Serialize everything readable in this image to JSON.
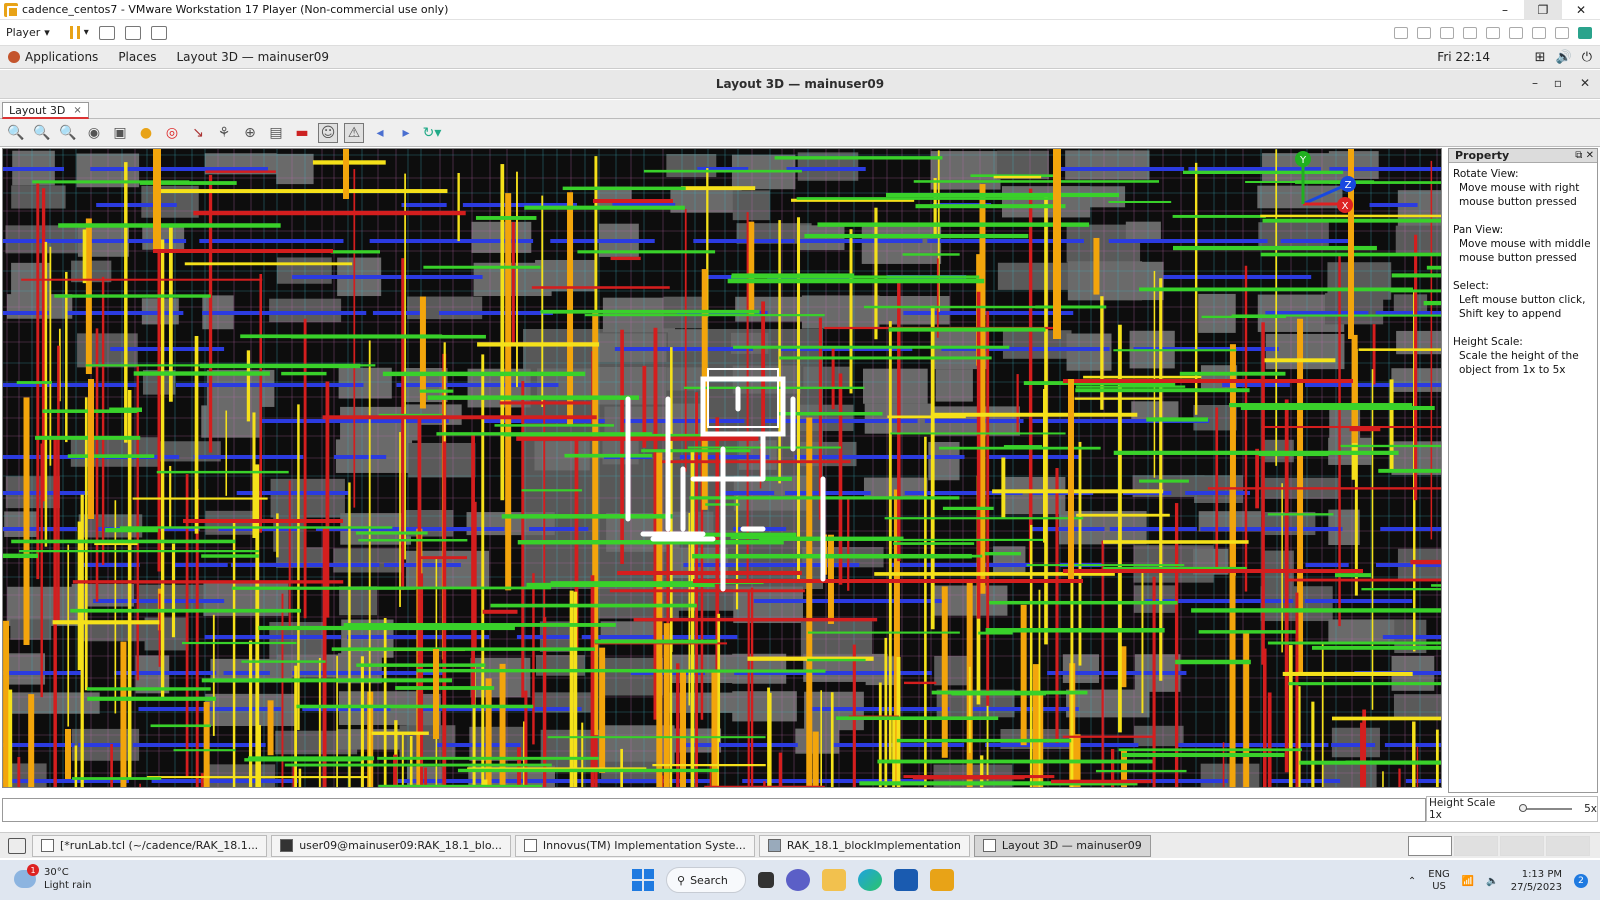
{
  "vmware": {
    "title": "cadence_centos7 - VMware Workstation 17 Player (Non-commercial use only)",
    "player_label": "Player",
    "window_controls": {
      "minimize": "–",
      "restore": "❐",
      "close": "✕"
    }
  },
  "gnome": {
    "applications": "Applications",
    "places": "Places",
    "active_window": "Layout 3D — mainuser09",
    "clock": "Fri 22:14"
  },
  "app": {
    "window_title": "Layout 3D — mainuser09",
    "tab_label": "Layout 3D",
    "tab_close": "×",
    "toolbar_icons": [
      "zoom-in-icon",
      "zoom-out-icon",
      "zoom-fit-icon",
      "binoculars-icon",
      "zoom-box-icon",
      "sphere-icon",
      "target-icon",
      "route-icon",
      "tree-icon",
      "globe-icon",
      "print-icon",
      "screenshot-icon",
      "person-icon",
      "warning-icon",
      "arrow-left-icon",
      "arrow-right-icon",
      "refresh-icon"
    ]
  },
  "property": {
    "header": "Property",
    "sections": [
      {
        "title": "Rotate View:",
        "text": "Move mouse with right mouse button pressed"
      },
      {
        "title": "Pan View:",
        "text": "Move mouse with middle mouse button pressed"
      },
      {
        "title": "Select:",
        "text": "Left mouse button click, Shift key to append"
      },
      {
        "title": "Height Scale:",
        "text": "Scale the height of the object from 1x to 5x"
      }
    ]
  },
  "height_scale": {
    "label": "Height Scale 1x",
    "max": "5x",
    "value": 1
  },
  "axes": {
    "y": "Y",
    "z": "Z",
    "x": "X"
  },
  "window_list": [
    {
      "label": "[*runLab.tcl (~/cadence/RAK_18.1...",
      "icon": "text-editor-icon",
      "active": false
    },
    {
      "label": "user09@mainuser09:RAK_18.1_blo...",
      "icon": "terminal-icon",
      "active": false
    },
    {
      "label": "Innovus(TM) Implementation Syste...",
      "icon": "innovus-icon",
      "active": false
    },
    {
      "label": "RAK_18.1_blockImplementation",
      "icon": "file-manager-icon",
      "active": false
    },
    {
      "label": "Layout 3D — mainuser09",
      "icon": "layout-icon",
      "active": true
    }
  ],
  "taskbar": {
    "weather_temp": "30°C",
    "weather_desc": "Light rain",
    "weather_badge": "1",
    "search_label": "Search",
    "lang_1": "ENG",
    "lang_2": "US",
    "time": "1:13 PM",
    "date": "27/5/2023",
    "notifications": "2"
  },
  "colors": {
    "metal_green": "#39d12a",
    "metal_yellow": "#f5e11a",
    "metal_red": "#d41e1e",
    "metal_blue": "#2b3be0",
    "metal_orange": "#f2a50c",
    "grid_cyan": "#3fb8c6",
    "grid_pink": "#c06ab0",
    "selection": "#ffffff",
    "vmware_accent": "#e8a317"
  }
}
